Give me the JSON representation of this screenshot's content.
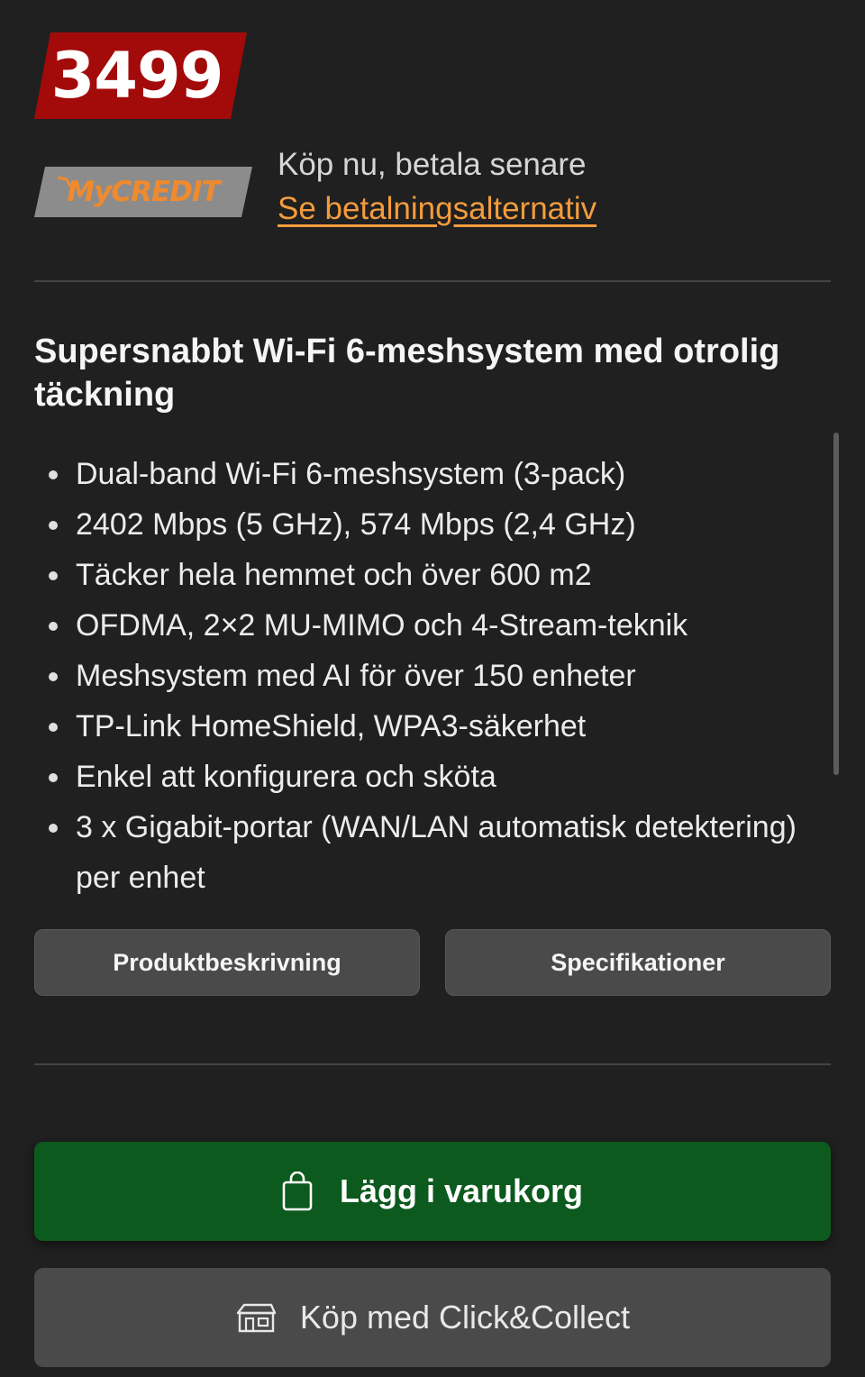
{
  "price": {
    "value": "3499",
    "badge_color": "#a30a0a"
  },
  "credit": {
    "logo_text": "MyCREDIT",
    "logo_color": "#f08a2e",
    "tagline": "Köp nu, betala senare",
    "link": "Se betalningsalternativ"
  },
  "product": {
    "headline": "Supersnabbt Wi-Fi 6-meshsystem med otrolig täckning",
    "features": [
      "Dual-band Wi-Fi 6-meshsystem (3-pack)",
      "2402 Mbps (5 GHz), 574 Mbps (2,4 GHz)",
      "Täcker hela hemmet och över 600 m2",
      "OFDMA, 2×2 MU-MIMO och 4-Stream-teknik",
      "Meshsystem med AI för över 150 enheter",
      "TP-Link HomeShield, WPA3-säkerhet",
      "Enkel att konfigurera och sköta",
      "3 x Gigabit-portar (WAN/LAN automatisk detektering) per enhet"
    ]
  },
  "tabs": {
    "description": "Produktbeskrivning",
    "specifications": "Specifikationer"
  },
  "actions": {
    "add_to_cart": "Lägg i varukorg",
    "add_to_cart_icon": "shopping-bag-icon",
    "add_to_cart_color": "#0c5a1e",
    "click_collect": "Köp med Click&Collect",
    "click_collect_icon": "store-icon"
  }
}
